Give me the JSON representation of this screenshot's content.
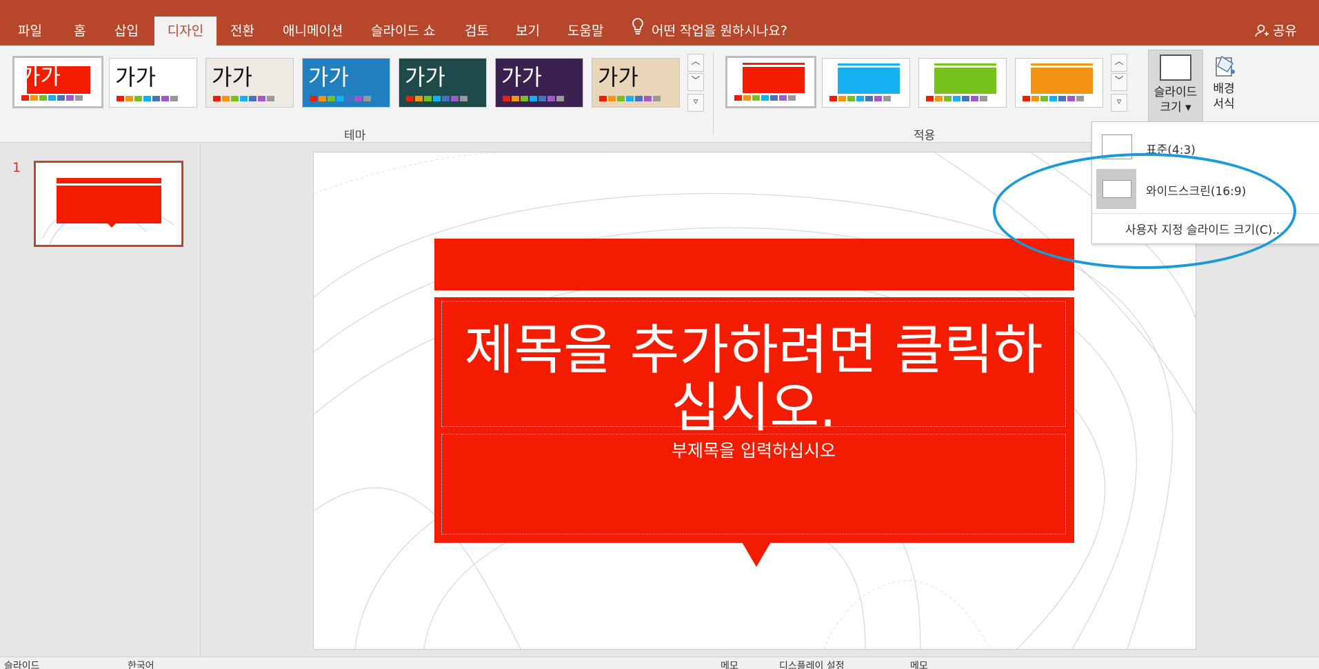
{
  "tabs": [
    "파일",
    "홈",
    "삽입",
    "디자인",
    "전환",
    "애니메이션",
    "슬라이드 쇼",
    "검토",
    "보기",
    "도움말"
  ],
  "active_tab": "디자인",
  "tell_me": "어떤 작업을 원하시나요?",
  "share_label": "공유",
  "themes": {
    "thumb_text": "가가",
    "items": [
      {
        "name": "theme-1",
        "bg": "#ffffff",
        "accent": "#f41c00"
      },
      {
        "name": "theme-2",
        "bg": "#ffffff",
        "accent": "#4472c4"
      },
      {
        "name": "theme-3",
        "bg": "#efe9e4",
        "accent": "#a0522d"
      },
      {
        "name": "theme-4",
        "bg": "#1f7fbf",
        "accent": "#7ec8ff"
      },
      {
        "name": "theme-5",
        "bg": "#1f4a4a",
        "accent": "#e02020"
      },
      {
        "name": "theme-6",
        "bg": "#3a2150",
        "accent": "#c02080"
      },
      {
        "name": "theme-7",
        "bg": "#e9d6b8",
        "accent": "#333333"
      }
    ],
    "group_label": "테마"
  },
  "variants": {
    "colors": [
      "#f41c00",
      "#16b0f0",
      "#77c21a",
      "#f39413"
    ],
    "group_label": "적용"
  },
  "slide_size_button": {
    "line1": "슬라이드",
    "line2": "크기 ▾"
  },
  "background_button": {
    "line1": "배경",
    "line2": "서식"
  },
  "slide_number": "1",
  "slide": {
    "title_line1": "제목을 추가하려면 클릭하",
    "title_line2": "십시오.",
    "subtitle": "부제목을 입력하십시오"
  },
  "dropdown": {
    "standard": "표준(4:3)",
    "widescreen": "와이드스크린(16:9)",
    "custom": "사용자 지정 슬라이드 크기(C)..."
  },
  "status": {
    "left": "슬라이드",
    "lang": "한국어",
    "notes": "메모",
    "display": "디스플레이 설정",
    "comments": "메모"
  }
}
